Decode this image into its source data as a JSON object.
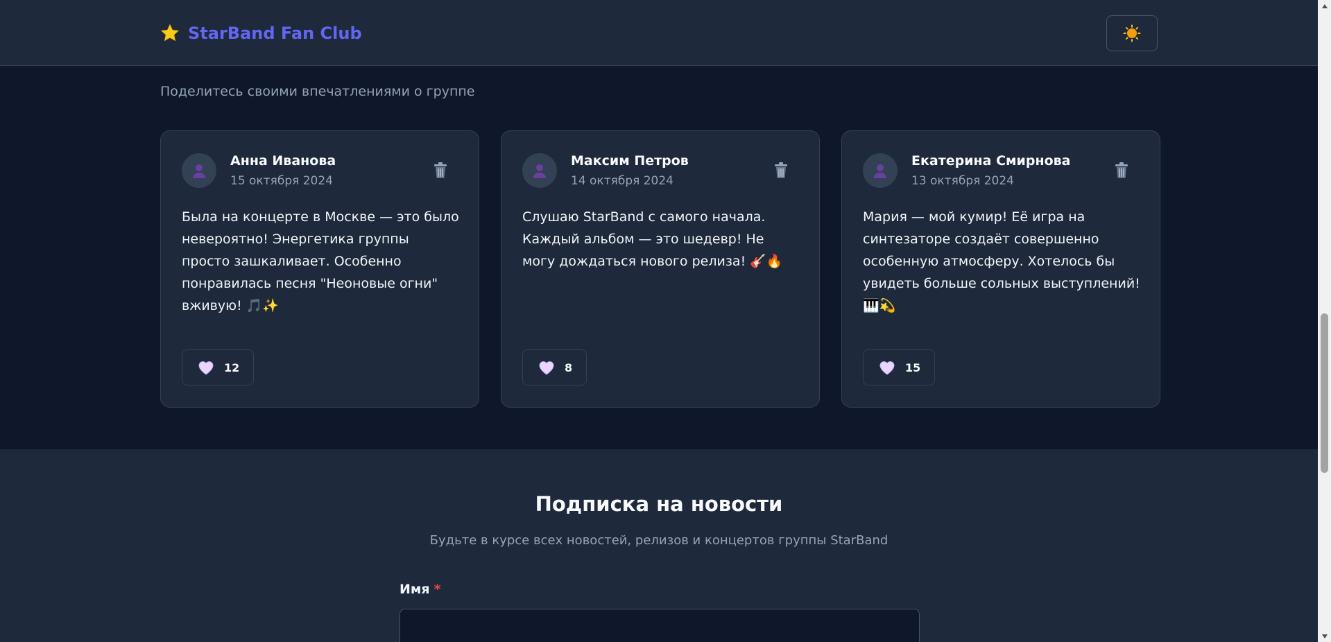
{
  "header": {
    "brand_icon": "star-icon",
    "brand_title": "StarBand Fan Club",
    "theme_toggle_icon": "sun-icon"
  },
  "reviews": {
    "subtitle": "Поделитесь своими впечатлениями о группе",
    "items": [
      {
        "author": "Анна Иванова",
        "date": "15 октября 2024",
        "text": "Была на концерте в Москве — это было невероятно! Энергетика группы просто зашкаливает. Особенно понравилась песня \"Неоновые огни\" вживую! 🎵✨",
        "likes": "12"
      },
      {
        "author": "Максим Петров",
        "date": "14 октября 2024",
        "text": "Слушаю StarBand с самого начала. Каждый альбом — это шедевр! Не могу дождаться нового релиза! 🎸🔥",
        "likes": "8"
      },
      {
        "author": "Екатерина Смирнова",
        "date": "13 октября 2024",
        "text": "Мария — мой кумир! Её игра на синтезаторе создаёт совершенно особенную атмосферу. Хотелось бы увидеть больше сольных выступлений! 🎹💫",
        "likes": "15"
      }
    ]
  },
  "newsletter": {
    "title": "Подписка на новости",
    "subtitle": "Будьте в курсе всех новостей, релизов и концертов группы StarBand",
    "name_label": "Имя",
    "required_mark": "*",
    "name_value": ""
  },
  "colors": {
    "accent": "#6366f1",
    "background": "#0f172a",
    "surface": "#1e293b",
    "required": "#ef4444"
  }
}
